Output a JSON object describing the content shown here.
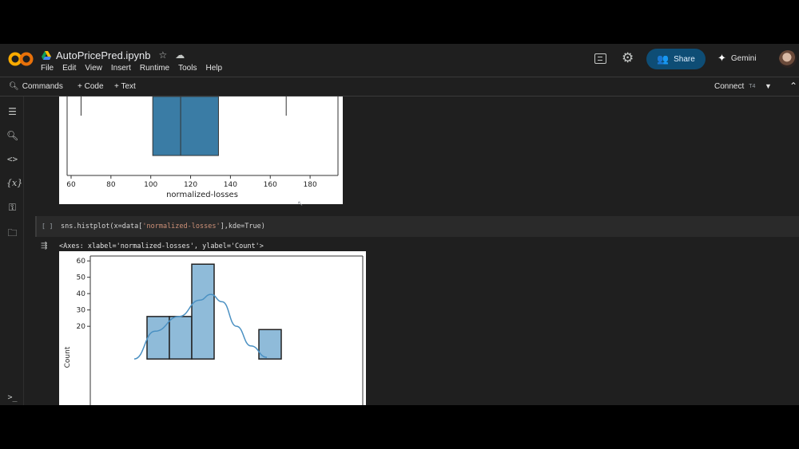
{
  "header": {
    "file_name": "AutoPricePred.ipynb",
    "menu": [
      "File",
      "Edit",
      "View",
      "Insert",
      "Runtime",
      "Tools",
      "Help"
    ],
    "share_label": "Share",
    "gemini_label": "Gemini"
  },
  "toolbar": {
    "commands_label": "Commands",
    "add_code_label": "+ Code",
    "add_text_label": "+ Text",
    "connect_label": "Connect",
    "connect_count": "T4"
  },
  "cells": {
    "run_brackets": "[ ]",
    "code_prefix": "sns.histplot(x=data[",
    "code_string": "'normalized-losses'",
    "code_suffix": "],kde=True)",
    "output_text": "<Axes: xlabel='normalized-losses', ylabel='Count'>"
  },
  "colors": {
    "accent_share": "#0e4d75",
    "box_fill": "#3a7ca5",
    "hist_fill": "#8fbbd9",
    "kde_line": "#4a90c2"
  },
  "icons": [
    "colab-logo-icon",
    "drive-icon",
    "star-icon",
    "cloud-icon",
    "comment-icon",
    "gear-icon",
    "people-icon",
    "gemini-icon",
    "toc-icon",
    "find-icon",
    "code-icon",
    "variables-icon",
    "key-icon",
    "folder-icon",
    "terminal-icon",
    "output-toggle-icon"
  ],
  "chart_data": [
    {
      "type": "box",
      "xlabel": "normalized-losses",
      "x_ticks": [
        60,
        80,
        100,
        120,
        140,
        160,
        180
      ],
      "xlim": [
        58,
        194
      ],
      "whisker_low": 65,
      "q1": 101,
      "median": 115,
      "q3": 134,
      "whisker_high": 168
    },
    {
      "type": "histogram",
      "ylabel": "Count",
      "y_ticks": [
        20,
        30,
        40,
        50,
        60
      ],
      "ylim": [
        0,
        63
      ],
      "bins": [
        {
          "index": 0,
          "count": 26
        },
        {
          "index": 1,
          "count": 26
        },
        {
          "index": 2,
          "count": 58
        },
        {
          "index": 5,
          "count": 18
        }
      ],
      "kde": true
    }
  ]
}
